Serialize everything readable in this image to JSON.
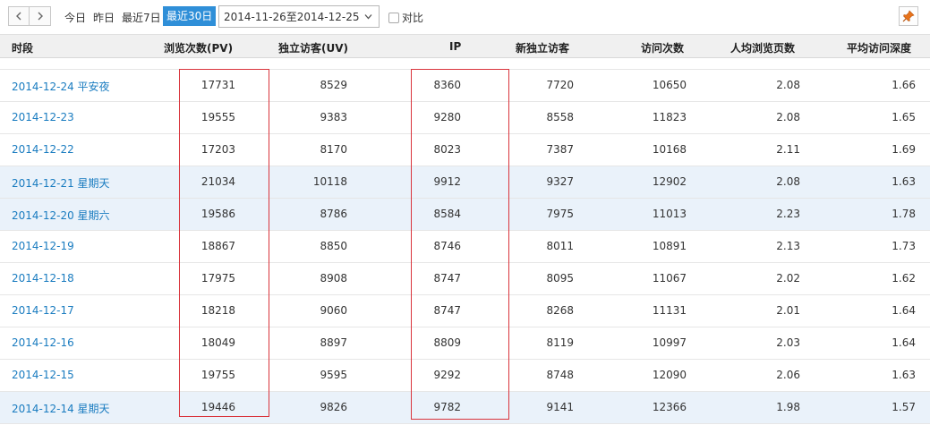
{
  "toolbar": {
    "quick": [
      "今日",
      "昨日",
      "最近7日"
    ],
    "active": "最近30日",
    "date_range": "2014-11-26至2014-12-25",
    "compare_label": "对比"
  },
  "headers": [
    "时段",
    "浏览次数(PV)",
    "独立访客(UV)",
    "IP",
    "新独立访客",
    "访问次数",
    "人均浏览页数",
    "平均访问深度"
  ],
  "rows": [
    {
      "date": "2014-12-24 平安夜",
      "pv": "17731",
      "uv": "8529",
      "ip": "8360",
      "new_uv": "7720",
      "visits": "10650",
      "ppv": "2.08",
      "depth": "1.66",
      "weekend": false
    },
    {
      "date": "2014-12-23",
      "pv": "19555",
      "uv": "9383",
      "ip": "9280",
      "new_uv": "8558",
      "visits": "11823",
      "ppv": "2.08",
      "depth": "1.65",
      "weekend": false
    },
    {
      "date": "2014-12-22",
      "pv": "17203",
      "uv": "8170",
      "ip": "8023",
      "new_uv": "7387",
      "visits": "10168",
      "ppv": "2.11",
      "depth": "1.69",
      "weekend": false
    },
    {
      "date": "2014-12-21 星期天",
      "pv": "21034",
      "uv": "10118",
      "ip": "9912",
      "new_uv": "9327",
      "visits": "12902",
      "ppv": "2.08",
      "depth": "1.63",
      "weekend": true
    },
    {
      "date": "2014-12-20 星期六",
      "pv": "19586",
      "uv": "8786",
      "ip": "8584",
      "new_uv": "7975",
      "visits": "11013",
      "ppv": "2.23",
      "depth": "1.78",
      "weekend": true
    },
    {
      "date": "2014-12-19",
      "pv": "18867",
      "uv": "8850",
      "ip": "8746",
      "new_uv": "8011",
      "visits": "10891",
      "ppv": "2.13",
      "depth": "1.73",
      "weekend": false
    },
    {
      "date": "2014-12-18",
      "pv": "17975",
      "uv": "8908",
      "ip": "8747",
      "new_uv": "8095",
      "visits": "11067",
      "ppv": "2.02",
      "depth": "1.62",
      "weekend": false
    },
    {
      "date": "2014-12-17",
      "pv": "18218",
      "uv": "9060",
      "ip": "8747",
      "new_uv": "8268",
      "visits": "11131",
      "ppv": "2.01",
      "depth": "1.64",
      "weekend": false
    },
    {
      "date": "2014-12-16",
      "pv": "18049",
      "uv": "8897",
      "ip": "8809",
      "new_uv": "8119",
      "visits": "10997",
      "ppv": "2.03",
      "depth": "1.64",
      "weekend": false
    },
    {
      "date": "2014-12-15",
      "pv": "19755",
      "uv": "9595",
      "ip": "9292",
      "new_uv": "8748",
      "visits": "12090",
      "ppv": "2.06",
      "depth": "1.63",
      "weekend": false
    },
    {
      "date": "2014-12-14 星期天",
      "pv": "19446",
      "uv": "9826",
      "ip": "9782",
      "new_uv": "9141",
      "visits": "12366",
      "ppv": "1.98",
      "depth": "1.57",
      "weekend": true
    }
  ],
  "colors": {
    "accent": "#2f8fd8",
    "link": "#1a7cc0",
    "weekend_row": "#eaf2fa",
    "highlight": "#d9343c",
    "pin": "#e8731a"
  },
  "icons": [
    "chevron-left-icon",
    "chevron-right-icon",
    "calendar-caret-icon",
    "checkbox-icon",
    "pin-icon"
  ]
}
